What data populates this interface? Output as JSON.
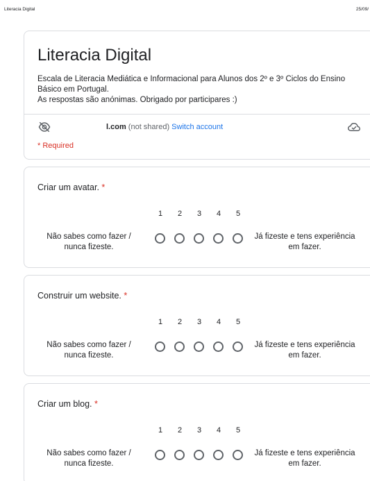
{
  "print_header": {
    "page_title": "Literacia Digital",
    "date": "25/09/"
  },
  "form": {
    "title": "Literacia Digital",
    "description_line1": "Escala de Literacia Mediática e Informacional para Alunos dos 2º e 3º Ciclos do Ensino Básico em Portugal.",
    "description_line2": "As respostas são anónimas. Obrigado por participares :)",
    "account_email": "l.com",
    "not_shared": "(not shared)",
    "switch_account": "Switch account",
    "required_note": "* Required"
  },
  "scale": {
    "numbers": [
      "1",
      "2",
      "3",
      "4",
      "5"
    ],
    "low_label": "Não sabes como fazer / nunca fizeste.",
    "high_label": "Já fizeste e tens experiência em fazer."
  },
  "questions": [
    {
      "title": "Criar um avatar.",
      "star": "*"
    },
    {
      "title": "Construir um website.",
      "star": "*"
    },
    {
      "title": "Criar um blog.",
      "star": "*"
    }
  ],
  "icons": {
    "visibility": "eye-off-icon",
    "cloud": "cloud-done-icon"
  },
  "colors": {
    "required": "#d93025",
    "link": "#1a73e8",
    "border": "#dadce0"
  }
}
